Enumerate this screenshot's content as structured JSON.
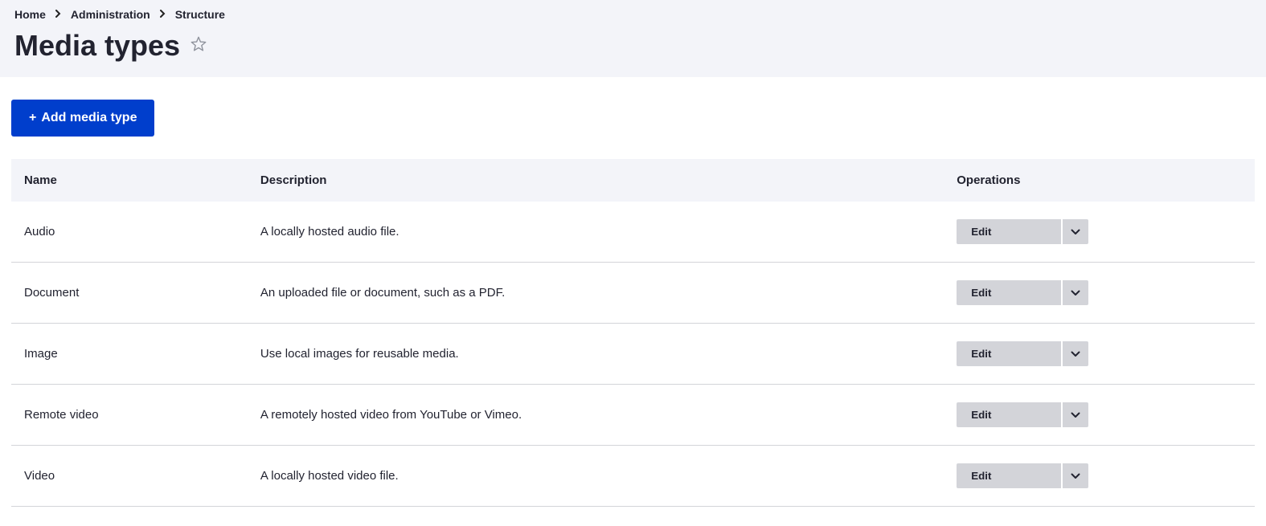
{
  "breadcrumb": {
    "items": [
      {
        "label": "Home"
      },
      {
        "label": "Administration"
      },
      {
        "label": "Structure"
      }
    ]
  },
  "page": {
    "title": "Media types"
  },
  "actions": {
    "add_label": "Add media type"
  },
  "table": {
    "headers": {
      "name": "Name",
      "description": "Description",
      "operations": "Operations"
    },
    "edit_label": "Edit",
    "rows": [
      {
        "name": "Audio",
        "description": "A locally hosted audio file."
      },
      {
        "name": "Document",
        "description": "An uploaded file or document, such as a PDF."
      },
      {
        "name": "Image",
        "description": "Use local images for reusable media."
      },
      {
        "name": "Remote video",
        "description": "A remotely hosted video from YouTube or Vimeo."
      },
      {
        "name": "Video",
        "description": "A locally hosted video file."
      }
    ]
  }
}
